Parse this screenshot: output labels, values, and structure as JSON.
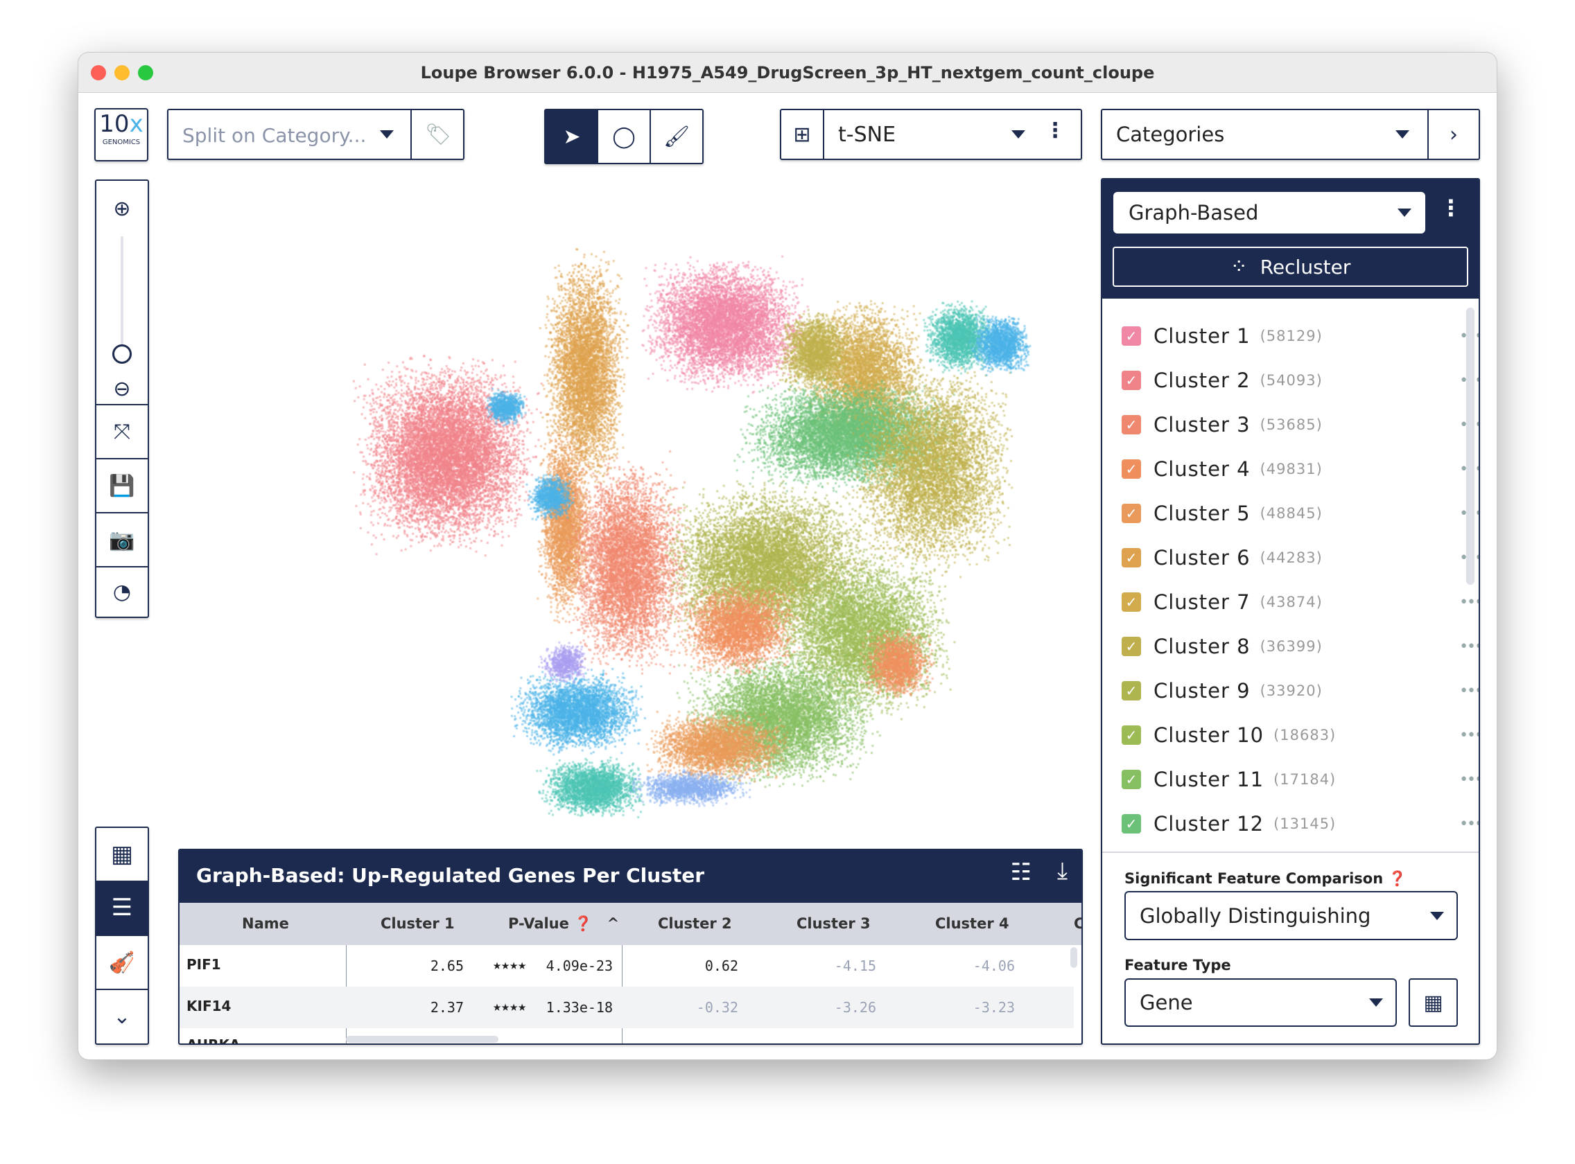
{
  "window": {
    "title": "Loupe Browser 6.0.0 - H1975_A549_DrugScreen_3p_HT_nextgem_count_cloupe"
  },
  "logo": {
    "text": "10x",
    "sub": "GENOMICS"
  },
  "toolbar": {
    "split_placeholder": "Split on Category...",
    "projection": "t-SNE",
    "panel_select": "Categories"
  },
  "clustering": {
    "selected": "Graph-Based",
    "recluster_label": "Recluster"
  },
  "clusters": [
    {
      "name": "Cluster 1",
      "count": "(58129)",
      "color": "#f087a5"
    },
    {
      "name": "Cluster 2",
      "count": "(54093)",
      "color": "#f0838a"
    },
    {
      "name": "Cluster 3",
      "count": "(53685)",
      "color": "#f0886f"
    },
    {
      "name": "Cluster 4",
      "count": "(49831)",
      "color": "#f08f5e"
    },
    {
      "name": "Cluster 5",
      "count": "(48845)",
      "color": "#e99a5a"
    },
    {
      "name": "Cluster 6",
      "count": "(44283)",
      "color": "#dea24f"
    },
    {
      "name": "Cluster 7",
      "count": "(43874)",
      "color": "#d1ab4c"
    },
    {
      "name": "Cluster 8",
      "count": "(36399)",
      "color": "#bfb04d"
    },
    {
      "name": "Cluster 9",
      "count": "(33920)",
      "color": "#aeb54f"
    },
    {
      "name": "Cluster 10",
      "count": "(18683)",
      "color": "#9dbb55"
    },
    {
      "name": "Cluster 11",
      "count": "(17184)",
      "color": "#86c062"
    },
    {
      "name": "Cluster 12",
      "count": "(13145)",
      "color": "#6cc178"
    }
  ],
  "comparison": {
    "label": "Significant Feature Comparison",
    "value": "Globally Distinguishing",
    "feature_type_label": "Feature Type",
    "feature_type": "Gene"
  },
  "table": {
    "title": "Graph-Based: Up-Regulated Genes Per Cluster",
    "columns": [
      "Name",
      "Cluster 1",
      "P-Value",
      "Cluster 2",
      "Cluster 3",
      "Cluster 4",
      "C"
    ],
    "rows": [
      {
        "name": "PIF1",
        "c1": "2.65",
        "stars": "★★★★",
        "p": "4.09e-23",
        "c2": "0.62",
        "c3": "-4.15",
        "c4": "-4.06"
      },
      {
        "name": "KIF14",
        "c1": "2.37",
        "stars": "★★★★",
        "p": "1.33e-18",
        "c2": "-0.32",
        "c3": "-3.26",
        "c4": "-3.23"
      },
      {
        "name": "AURKA"
      }
    ]
  },
  "colors": {
    "navy": "#1b2a4e",
    "accent_blue": "#4ab3e8",
    "teal": "#4dc4b4"
  }
}
